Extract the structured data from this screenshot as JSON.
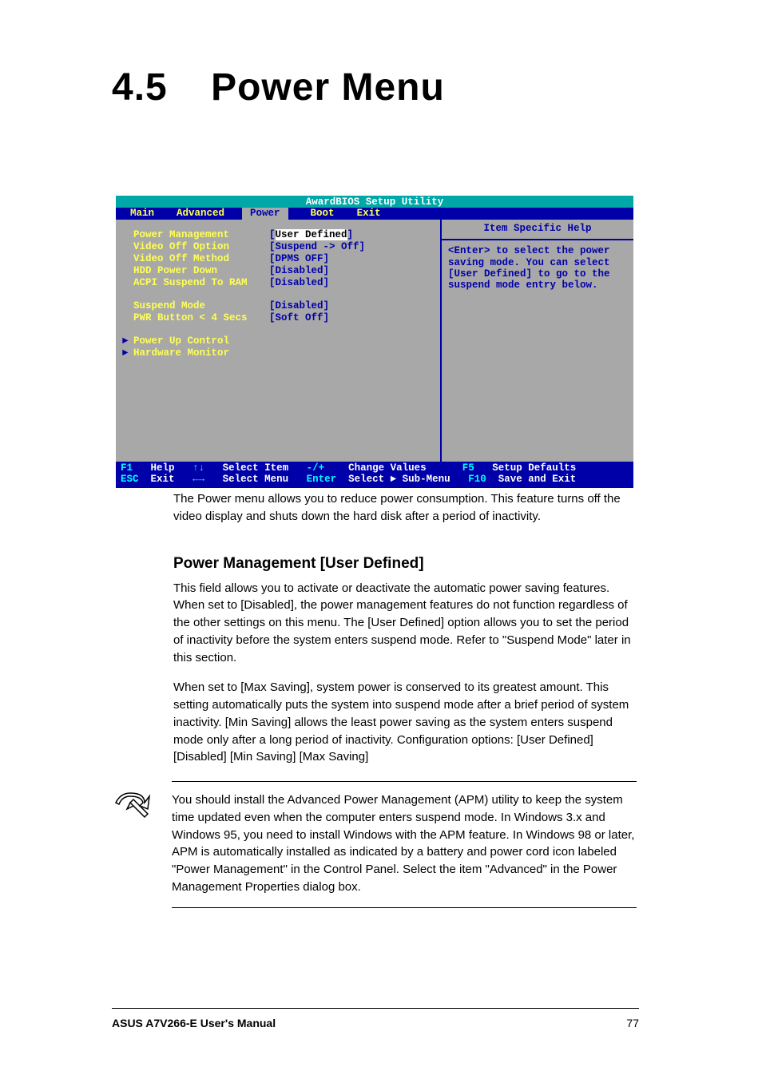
{
  "heading": {
    "number": "4.5",
    "title": "Power Menu"
  },
  "intro": "The Power menu allows you to reduce power consumption. This feature turns off the video display and shuts down the hard disk after a period of inactivity.",
  "bios": {
    "title": "AwardBIOS Setup Utility",
    "menus": [
      "Main",
      "Advanced",
      "Power",
      "Boot",
      "Exit"
    ],
    "active_menu_index": 2,
    "items": [
      {
        "label": "Power Management",
        "value": "User Defined",
        "selected": true
      },
      {
        "label": "Video Off Option",
        "value": "Suspend -> Off"
      },
      {
        "label": "Video Off Method",
        "value": "DPMS OFF"
      },
      {
        "label": "HDD Power Down",
        "value": "Disabled"
      },
      {
        "label": "ACPI Suspend To RAM",
        "value": "Disabled"
      },
      {
        "label": "Suspend Mode",
        "value": "Disabled",
        "gap_before": true
      },
      {
        "label": "PWR Button < 4 Secs",
        "value": "Soft Off"
      }
    ],
    "submenus": [
      "Power Up Control",
      "Hardware Monitor"
    ],
    "help": {
      "title": "Item Specific Help",
      "body": "<Enter> to select the power saving mode. You can select [User Defined] to go to the suspend mode entry below."
    },
    "footer": {
      "line1": {
        "k1": "F1",
        "t1": "Help",
        "k2": "↑↓",
        "t2": "Select Item",
        "k3": "-/+",
        "t3": "Change Values",
        "k4": "F5",
        "t4": "Setup Defaults"
      },
      "line2": {
        "k1": "ESC",
        "t1": "Exit",
        "k2": "←→",
        "t2": "Select Menu",
        "k3": "Enter",
        "t3": "Select ► Sub-Menu",
        "k4": "F10",
        "t4": "Save and Exit"
      }
    }
  },
  "section": {
    "heading": "Power Management [User Defined]",
    "p1": "This field allows you to activate or deactivate the automatic power saving features. When set to [Disabled], the power management features do not function regardless of the other settings on this menu. The [User Defined] option allows you to set the period of inactivity before the system enters suspend mode. Refer to \"Suspend Mode\" later in this section.",
    "p2": "When set to [Max Saving], system power is conserved to its greatest amount. This setting automatically puts the system into suspend mode after a brief period of system inactivity. [Min Saving] allows the least power saving as the system enters suspend mode only after a long period of inactivity. Configuration options: [User Defined] [Disabled] [Min Saving] [Max Saving]"
  },
  "note": "You should install the Advanced Power Management (APM) utility to keep the system time updated even when the computer enters suspend mode. In Windows 3.x and Windows 95, you need to install Windows with the APM feature. In Windows 98 or later, APM is automatically installed as indicated by a battery and power cord icon labeled \"Power Management\" in the Control Panel. Select the item \"Advanced\" in the Power Management Properties dialog box.",
  "footer": {
    "left": "ASUS A7V266-E User's Manual",
    "right": "77"
  }
}
